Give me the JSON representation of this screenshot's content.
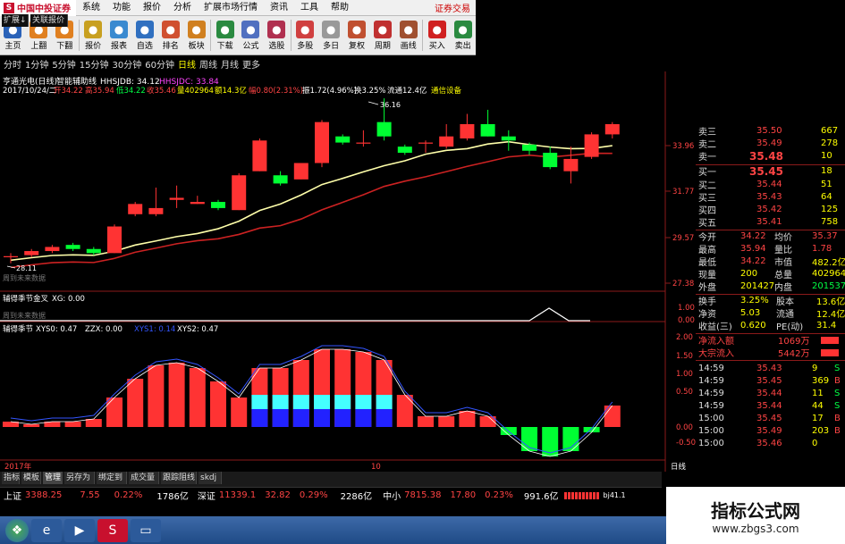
{
  "menubar": {
    "logo_text": "中国中投证券",
    "items": [
      "系统",
      "功能",
      "报价",
      "分析",
      "扩展市场行情",
      "资讯",
      "工具",
      "帮助"
    ],
    "broker": "证券交易"
  },
  "toolbar": [
    {
      "label": "主页",
      "icon": "home-icon",
      "color": "#2a62b8"
    },
    {
      "label": "上翻",
      "icon": "arrow-up-icon",
      "color": "#e08020"
    },
    {
      "label": "下翻",
      "icon": "arrow-down-icon",
      "color": "#e08020"
    },
    {
      "label": "报价",
      "icon": "quote-icon",
      "color": "#c8a020"
    },
    {
      "label": "报表",
      "icon": "report-icon",
      "color": "#3a8ad0"
    },
    {
      "label": "自选",
      "icon": "favorite-icon",
      "color": "#3070c0"
    },
    {
      "label": "排名",
      "icon": "rank-icon",
      "color": "#d05030"
    },
    {
      "label": "板块",
      "icon": "sector-icon",
      "color": "#d08020"
    },
    {
      "label": "下载",
      "icon": "download-icon",
      "color": "#2a8a40"
    },
    {
      "label": "公式",
      "icon": "formula-icon",
      "color": "#5070c0"
    },
    {
      "label": "选股",
      "icon": "select-stock-icon",
      "color": "#b03050"
    },
    {
      "label": "多股",
      "icon": "multi-stock-icon",
      "color": "#d04040"
    },
    {
      "label": "多日",
      "icon": "multi-day-icon",
      "color": "#999999"
    },
    {
      "label": "复权",
      "icon": "adjust-icon",
      "color": "#c05030"
    },
    {
      "label": "周期",
      "icon": "period-icon",
      "color": "#c03030"
    },
    {
      "label": "画线",
      "icon": "draw-line-icon",
      "color": "#a05030"
    },
    {
      "label": "买入",
      "icon": "buy-icon",
      "color": "#d02020"
    },
    {
      "label": "卖出",
      "icon": "sell-icon",
      "color": "#2a8a40"
    }
  ],
  "periods": [
    "分时",
    "1分钟",
    "5分钟",
    "15分钟",
    "30分钟",
    "60分钟",
    "日线",
    "周线",
    "月线",
    "更多"
  ],
  "active_period": "日线",
  "main_panel": {
    "stock_title": "亨通光电(日线)",
    "indicator_name": "智能辅助线",
    "hh_label": "HHSJDB: 34.12",
    "hd_label": "HHSJDC: 33.84",
    "date_line": "2017/10/24/二",
    "open": "开34.22",
    "high": "高35.94",
    "low": "低34.22",
    "close": "收35.46",
    "volume": "量402964",
    "amount": "额14.3亿",
    "change": "幅0.80(2.31%)",
    "swing": "振1.72(4.96%)",
    "turnover": "换3.25%",
    "float": "流通12.4亿",
    "note": "通信设备",
    "high_mark": "36.16",
    "low_mark": "28.11",
    "future_note": "周到未来数据"
  },
  "sub1": {
    "title": "辅得季节金叉",
    "value": "XG: 0.00",
    "future_note": "周到未来数据"
  },
  "sub2": {
    "title": "辅得季节",
    "xys0": "XYS0: 0.47",
    "zzx": "ZZX: 0.00",
    "xys1": "XYS1: 0.14",
    "xys2": "XYS2: 0.47"
  },
  "axis": {
    "main_ticks": [
      "33.96",
      "31.77",
      "29.57",
      "27.38"
    ],
    "sub1_ticks": [
      "1.00",
      "0.00"
    ],
    "sub2_ticks": [
      "2.00",
      "1.50",
      "1.00",
      "0.50",
      "0.00",
      "-0.50"
    ],
    "year_label": "2017年",
    "month_label": "10",
    "period_label": "日线"
  },
  "chart_data": {
    "type": "candlestick",
    "x_range": [
      1,
      31
    ],
    "y_range": [
      27.38,
      36.16
    ],
    "candles": [
      {
        "o": 28.4,
        "c": 28.45,
        "h": 28.6,
        "l": 28.1
      },
      {
        "o": 28.5,
        "c": 28.7,
        "h": 28.8,
        "l": 28.4
      },
      {
        "o": 28.7,
        "c": 28.9,
        "h": 29.0,
        "l": 28.6
      },
      {
        "o": 29.0,
        "c": 28.8,
        "h": 29.1,
        "l": 28.7
      },
      {
        "o": 28.8,
        "c": 28.6,
        "h": 28.9,
        "l": 28.5
      },
      {
        "o": 28.6,
        "c": 29.9,
        "h": 30.0,
        "l": 28.6
      },
      {
        "o": 30.5,
        "c": 31.0,
        "h": 31.1,
        "l": 30.4
      },
      {
        "o": 30.5,
        "c": 30.8,
        "h": 31.8,
        "l": 30.4
      },
      {
        "o": 31.2,
        "c": 31.3,
        "h": 31.9,
        "l": 30.8
      },
      {
        "o": 31.0,
        "c": 31.1,
        "h": 31.4,
        "l": 31.0
      },
      {
        "o": 31.1,
        "c": 30.8,
        "h": 31.2,
        "l": 30.7
      },
      {
        "o": 30.7,
        "c": 32.4,
        "h": 32.5,
        "l": 30.7
      },
      {
        "o": 32.6,
        "c": 34.1,
        "h": 34.2,
        "l": 32.6
      },
      {
        "o": 32.4,
        "c": 32.0,
        "h": 32.6,
        "l": 31.9
      },
      {
        "o": 32.2,
        "c": 33.0,
        "h": 33.0,
        "l": 32.2
      },
      {
        "o": 33.0,
        "c": 35.0,
        "h": 35.1,
        "l": 32.8
      },
      {
        "o": 34.3,
        "c": 34.0,
        "h": 34.4,
        "l": 33.9
      },
      {
        "o": 34.0,
        "c": 34.0,
        "h": 34.6,
        "l": 33.8
      },
      {
        "o": 35.0,
        "c": 34.3,
        "h": 36.16,
        "l": 34.1
      },
      {
        "o": 33.8,
        "c": 33.5,
        "h": 33.9,
        "l": 33.4
      },
      {
        "o": 34.0,
        "c": 34.0,
        "h": 34.1,
        "l": 33.5
      },
      {
        "o": 33.8,
        "c": 34.3,
        "h": 34.9,
        "l": 33.7
      },
      {
        "o": 34.2,
        "c": 34.9,
        "h": 35.4,
        "l": 34.1
      },
      {
        "o": 34.9,
        "c": 34.3,
        "h": 35.6,
        "l": 34.3
      },
      {
        "o": 34.3,
        "c": 34.1,
        "h": 34.6,
        "l": 33.6
      },
      {
        "o": 33.9,
        "c": 33.6,
        "h": 34.0,
        "l": 33.4
      },
      {
        "o": 33.5,
        "c": 32.8,
        "h": 33.8,
        "l": 32.7
      },
      {
        "o": 32.6,
        "c": 33.2,
        "h": 33.8,
        "l": 32.0
      },
      {
        "o": 33.3,
        "c": 34.4,
        "h": 34.5,
        "l": 33.2
      },
      {
        "o": 34.4,
        "c": 34.9,
        "h": 35.0,
        "l": 34.2
      }
    ]
  },
  "quote": {
    "sell": [
      {
        "label": "卖三",
        "price": "35.50",
        "vol": "667"
      },
      {
        "label": "卖二",
        "price": "35.49",
        "vol": "278"
      },
      {
        "label": "卖一",
        "price": "35.48",
        "vol": "10"
      }
    ],
    "buy": [
      {
        "label": "买一",
        "price": "35.45",
        "vol": "18"
      },
      {
        "label": "买二",
        "price": "35.44",
        "vol": "51"
      },
      {
        "label": "买三",
        "price": "35.43",
        "vol": "64"
      },
      {
        "label": "买四",
        "price": "35.42",
        "vol": "125"
      },
      {
        "label": "买五",
        "price": "35.41",
        "vol": "758"
      }
    ],
    "stats": [
      {
        "l1": "今开",
        "v1": "34.22",
        "l2": "均价",
        "v2": "35.37"
      },
      {
        "l1": "最高",
        "v1": "35.94",
        "l2": "量比",
        "v2": "1.78"
      },
      {
        "l1": "最低",
        "v1": "34.22",
        "l2": "市值",
        "v2": "482.2亿"
      },
      {
        "l1": "现量",
        "v1": "200",
        "l2": "总量",
        "v2": "402964"
      },
      {
        "l1": "外盘",
        "v1": "201427",
        "l2": "内盘",
        "v2": "201537"
      }
    ],
    "stats2": [
      {
        "l1": "换手",
        "v1": "3.25%",
        "l2": "股本",
        "v2": "13.6亿"
      },
      {
        "l1": "净资",
        "v1": "5.03",
        "l2": "流通",
        "v2": "12.4亿"
      },
      {
        "l1": "收益(三)",
        "v1": "0.620",
        "l2": "PE(动)",
        "v2": "31.4"
      }
    ],
    "flows": [
      {
        "label": "净流入额",
        "value": "1069万"
      },
      {
        "label": "大宗流入",
        "value": "5442万"
      }
    ],
    "ticks": [
      {
        "t": "14:59",
        "p": "35.43",
        "v": "9",
        "s": "S"
      },
      {
        "t": "14:59",
        "p": "35.45",
        "v": "369",
        "s": "B"
      },
      {
        "t": "14:59",
        "p": "35.44",
        "v": "11",
        "s": "S"
      },
      {
        "t": "14:59",
        "p": "35.44",
        "v": "44",
        "s": "S"
      },
      {
        "t": "15:00",
        "p": "35.45",
        "v": "17",
        "s": "B"
      },
      {
        "t": "15:00",
        "p": "35.49",
        "v": "203",
        "s": "B"
      },
      {
        "t": "15:00",
        "p": "35.46",
        "v": "0",
        "s": ""
      }
    ]
  },
  "bottom_tabs": [
    "指标",
    "模板",
    "管理",
    "另存为",
    "绑定到",
    "成交量",
    "跟踪阻线",
    "skdj"
  ],
  "sub_tabs": [
    "扩展↓",
    "关联报价"
  ],
  "statusbar": {
    "sh_label": "上证",
    "sh_val": "3388.25",
    "sh_chg": "7.55",
    "sh_pct": "0.22%",
    "sh_amt": "1786亿",
    "sz_label": "深证",
    "sz_val": "11339.1",
    "sz_chg": "32.82",
    "sz_pct": "0.29%",
    "sz_amt": "2286亿",
    "zx_label": "中小",
    "zx_val": "7815.38",
    "zx_chg": "17.80",
    "zx_pct": "0.23%",
    "zx_amt": "991.6亿",
    "extra": "bj41.1"
  },
  "watermark": {
    "title": "指标公式网",
    "url": "www.zbgs3.com"
  },
  "colors": {
    "up": "#ff3333",
    "down": "#00ff33",
    "ma1": "#ffffaa",
    "ma2": "#cc2222",
    "cyan": "#44ffff",
    "blue": "#2222ff"
  }
}
